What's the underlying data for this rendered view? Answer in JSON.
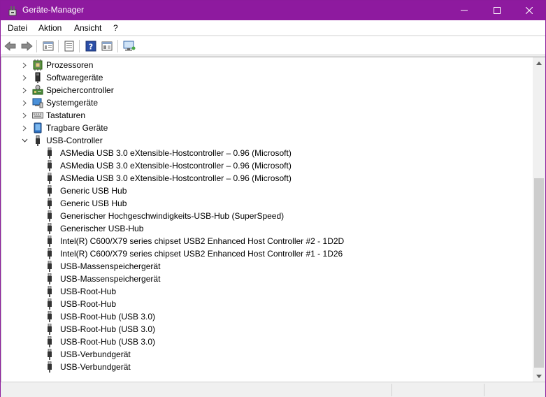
{
  "window": {
    "title": "Geräte-Manager",
    "title_bar_color": "#8e1a9f",
    "controls": {
      "minimize": "minimize-icon",
      "maximize": "maximize-icon",
      "close": "close-icon"
    }
  },
  "menu": {
    "items": [
      {
        "label": "Datei"
      },
      {
        "label": "Aktion"
      },
      {
        "label": "Ansicht"
      },
      {
        "label": "?"
      }
    ]
  },
  "toolbar": {
    "buttons": [
      "back-arrow-icon",
      "forward-arrow-icon",
      "properties-icon",
      "update-driver-icon",
      "help-icon",
      "view-icon",
      "monitor-icon"
    ]
  },
  "tree": {
    "categories": [
      {
        "label": "Prozessoren",
        "expanded": false,
        "icon": "processor-icon"
      },
      {
        "label": "Softwaregeräte",
        "expanded": false,
        "icon": "software-device-icon"
      },
      {
        "label": "Speichercontroller",
        "expanded": false,
        "icon": "storage-controller-icon"
      },
      {
        "label": "Systemgeräte",
        "expanded": false,
        "icon": "system-device-icon"
      },
      {
        "label": "Tastaturen",
        "expanded": false,
        "icon": "keyboard-icon"
      },
      {
        "label": "Tragbare Geräte",
        "expanded": false,
        "icon": "portable-device-icon"
      },
      {
        "label": "USB-Controller",
        "expanded": true,
        "icon": "usb-controller-icon"
      }
    ],
    "usb_devices": [
      "ASMedia USB 3.0 eXtensible-Hostcontroller – 0.96 (Microsoft)",
      "ASMedia USB 3.0 eXtensible-Hostcontroller – 0.96 (Microsoft)",
      "ASMedia USB 3.0 eXtensible-Hostcontroller – 0.96 (Microsoft)",
      "Generic USB Hub",
      "Generic USB Hub",
      "Generischer Hochgeschwindigkeits-USB-Hub (SuperSpeed)",
      "Generischer USB-Hub",
      "Intel(R) C600/X79 series chipset USB2 Enhanced Host Controller #2 - 1D2D",
      "Intel(R) C600/X79 series chipset USB2 Enhanced Host Controller #1 - 1D26",
      "USB-Massenspeichergerät",
      "USB-Massenspeichergerät",
      "USB-Root-Hub",
      "USB-Root-Hub",
      "USB-Root-Hub (USB 3.0)",
      "USB-Root-Hub (USB 3.0)",
      "USB-Root-Hub (USB 3.0)",
      "USB-Verbundgerät",
      "USB-Verbundgerät"
    ]
  }
}
